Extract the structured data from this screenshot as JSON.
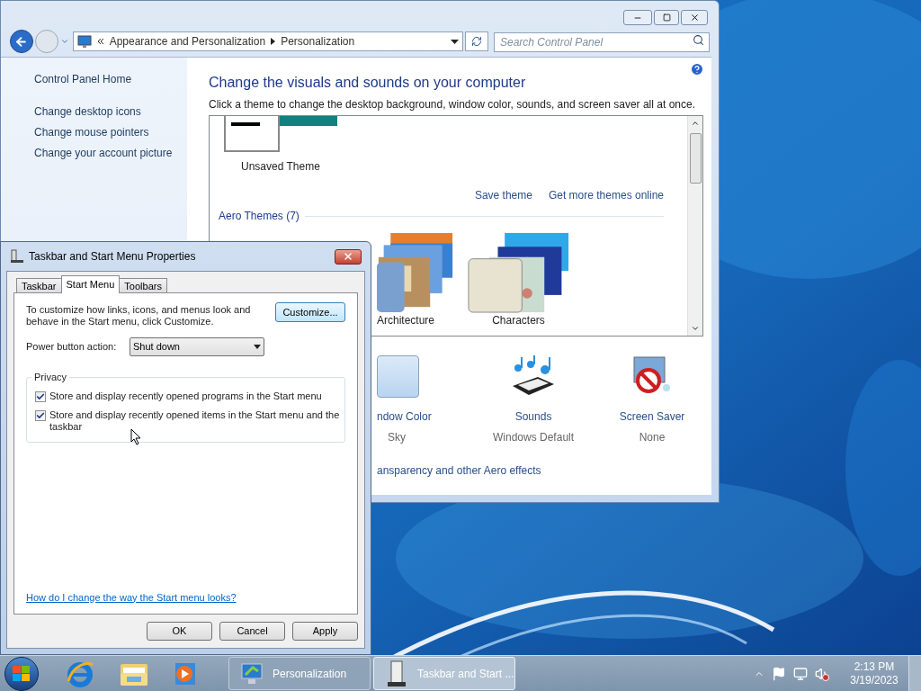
{
  "control_panel": {
    "address": {
      "crumbs": [
        "Appearance and Personalization",
        "Personalization"
      ]
    },
    "search": {
      "placeholder": "Search Control Panel"
    },
    "sidebar": {
      "items": [
        {
          "label": "Control Panel Home",
          "kind": "home"
        },
        {
          "label": "Change desktop icons",
          "kind": "task"
        },
        {
          "label": "Change mouse pointers",
          "kind": "task"
        },
        {
          "label": "Change your account picture",
          "kind": "task"
        }
      ]
    },
    "heading": "Change the visuals and sounds on your computer",
    "subtitle": "Click a theme to change the desktop background, window color, sounds, and screen saver all at once.",
    "themes": {
      "unsaved": "Unsaved Theme",
      "links": [
        "Save theme",
        "Get more themes online"
      ],
      "group": "Aero Themes (7)",
      "items": [
        {
          "label": "Architecture",
          "kind": "architecture"
        },
        {
          "label": "Characters",
          "kind": "characters"
        }
      ]
    },
    "settings": [
      {
        "label": "ndow Color",
        "value": "Sky",
        "kind": "color"
      },
      {
        "label": "Sounds",
        "value": "Windows Default",
        "kind": "sounds"
      },
      {
        "label": "Screen Saver",
        "value": "None",
        "kind": "screensaver"
      }
    ],
    "aero_link": "ansparency and other Aero effects"
  },
  "dialog": {
    "title": "Taskbar and Start Menu Properties",
    "tabs": [
      {
        "label": "Taskbar",
        "selected": false
      },
      {
        "label": "Start Menu",
        "selected": true
      },
      {
        "label": "Toolbars",
        "selected": false
      }
    ],
    "description": "To customize how links, icons, and menus look and behave in the Start menu, click Customize.",
    "customize_button": "Customize...",
    "power": {
      "label": "Power button action:",
      "value": "Shut down"
    },
    "privacy": {
      "title": "Privacy",
      "options": [
        {
          "label": "Store and display recently opened programs in the Start menu",
          "checked": true
        },
        {
          "label": "Store and display recently opened items in the Start menu and the taskbar",
          "checked": true
        }
      ]
    },
    "help_link": "How do I change the way the Start menu looks?",
    "buttons": [
      "OK",
      "Cancel",
      "Apply"
    ]
  },
  "taskbar": {
    "windows": [
      {
        "label": "Personalization",
        "kind": "personalization",
        "selected": false
      },
      {
        "label": "Taskbar and Start ...",
        "kind": "taskbar",
        "selected": true
      }
    ],
    "clock": {
      "time": "2:13 PM",
      "date": "3/19/2023"
    }
  }
}
